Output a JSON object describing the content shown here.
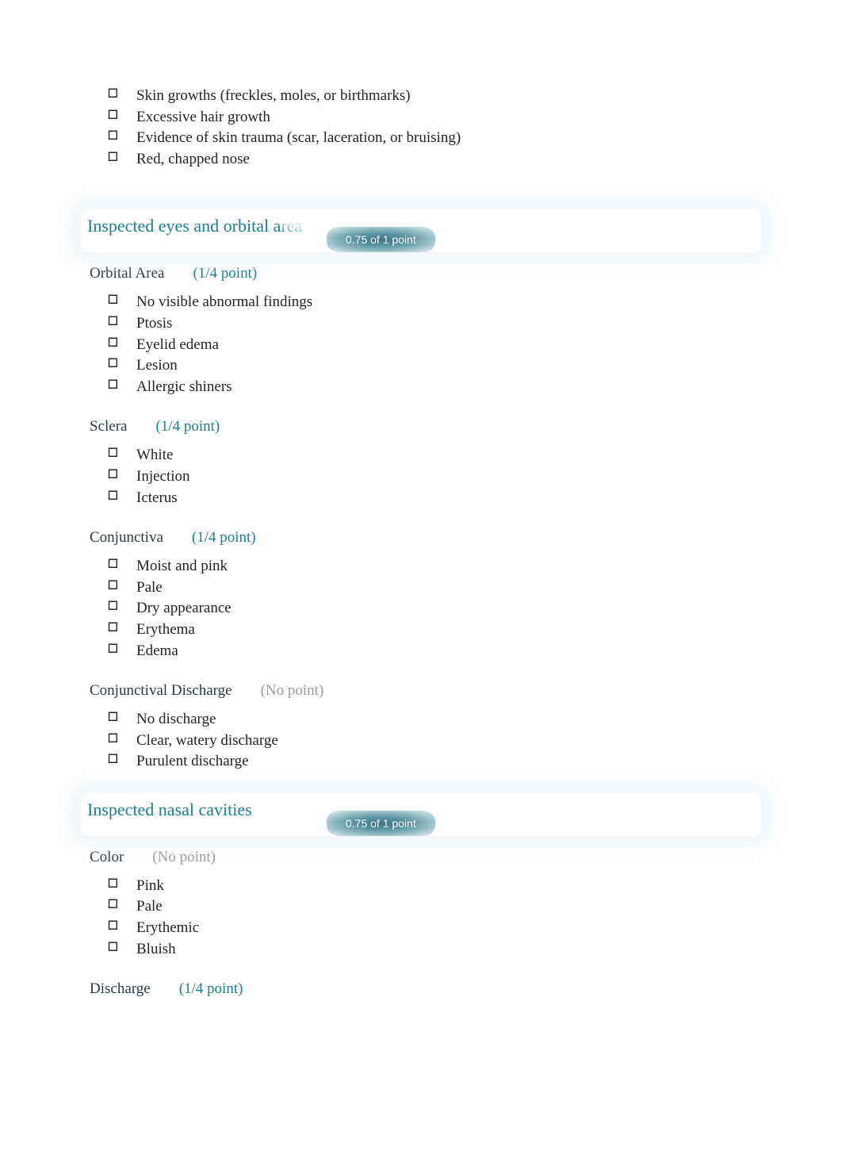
{
  "top_items": [
    "Skin growths (freckles, moles, or birthmarks)",
    "Excessive hair growth",
    "Evidence of skin trauma (scar, laceration, or bruising)",
    "Red, chapped nose"
  ],
  "sections": [
    {
      "title": "Inspected eyes and orbital area",
      "badge": "0.75 of 1 point",
      "groups": [
        {
          "label": "Orbital Area",
          "points": "(1/4 point)",
          "points_style": "teal",
          "items": [
            "No visible abnormal findings",
            "Ptosis",
            "Eyelid edema",
            "Lesion",
            "Allergic shiners"
          ]
        },
        {
          "label": "Sclera",
          "points": "(1/4 point)",
          "points_style": "teal",
          "items": [
            "White",
            "Injection",
            "Icterus"
          ]
        },
        {
          "label": "Conjunctiva",
          "points": "(1/4 point)",
          "points_style": "teal",
          "items": [
            "Moist and pink",
            "Pale",
            "Dry appearance",
            "Erythema",
            "Edema"
          ]
        },
        {
          "label": "Conjunctival Discharge",
          "points": "(No point)",
          "points_style": "gray",
          "items": [
            "No discharge",
            "Clear, watery discharge",
            "Purulent discharge"
          ]
        }
      ]
    },
    {
      "title": "Inspected nasal cavities",
      "badge": "0.75 of 1 point",
      "groups": [
        {
          "label": "Color",
          "points": "(No point)",
          "points_style": "gray",
          "items": [
            "Pink",
            "Pale",
            "Erythemic",
            "Bluish"
          ]
        },
        {
          "label": "Discharge",
          "points": "(1/4 point)",
          "points_style": "teal",
          "items": []
        }
      ]
    }
  ],
  "bullet_glyph": "🞐"
}
